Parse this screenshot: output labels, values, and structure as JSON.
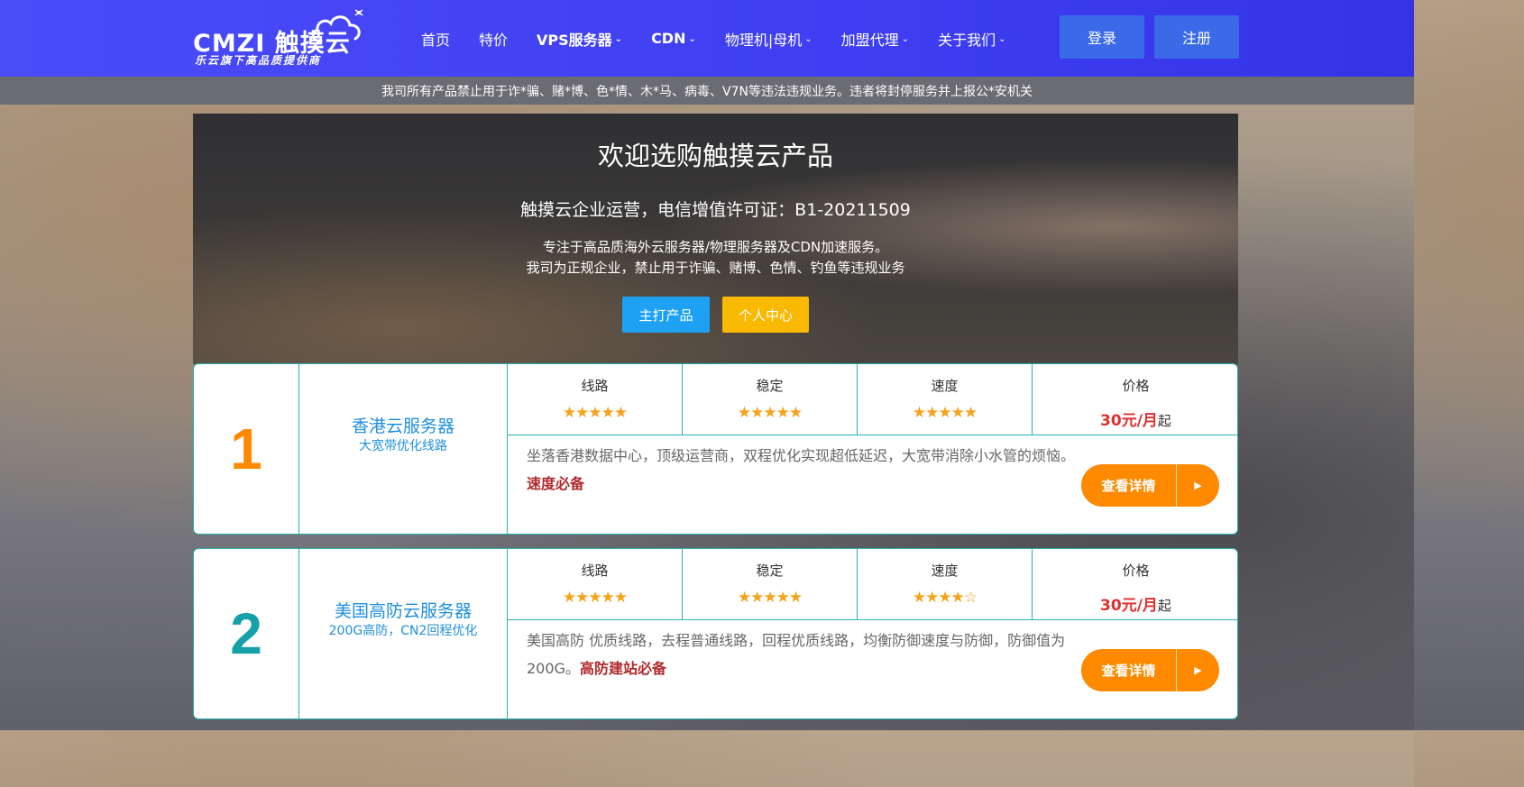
{
  "header": {
    "logo_text": "CMZI 触摸云",
    "logo_tagline": "乐云旗下高品质提供商",
    "nav": [
      {
        "label": "首页",
        "dropdown": false
      },
      {
        "label": "特价",
        "dropdown": false
      },
      {
        "label": "VPS服务器",
        "dropdown": true
      },
      {
        "label": "CDN",
        "dropdown": true
      },
      {
        "label": "物理机|母机",
        "dropdown": true
      },
      {
        "label": "加盟代理",
        "dropdown": true
      },
      {
        "label": "关于我们",
        "dropdown": true
      }
    ],
    "login_label": "登录",
    "register_label": "注册"
  },
  "notice": "我司所有产品禁止用于诈*骗、赌*博、色*情、木*马、病毒、V7N等违法违规业务。违者将封停服务并上报公*安机关",
  "hero": {
    "title": "欢迎选购触摸云产品",
    "license": "触摸云企业运营，电信增值许可证：B1-20211509",
    "desc_line1": "专注于高品质海外云服务器/物理服务器及CDN加速服务。",
    "desc_line2": "我司为正规企业，禁止用于诈骗、赌博、色情、钓鱼等违规业务",
    "primary_button": "主打产品",
    "secondary_button": "个人中心"
  },
  "products": [
    {
      "rank": "1",
      "name": "香港云服务器",
      "subtitle": "大宽带优化线路",
      "stats": [
        {
          "label": "线路",
          "rating": 5,
          "stars": "★★★★★"
        },
        {
          "label": "稳定",
          "rating": 5,
          "stars": "★★★★★"
        },
        {
          "label": "速度",
          "rating": 5,
          "stars": "★★★★★"
        }
      ],
      "price_label": "价格",
      "price": "30元/月",
      "price_suffix": "起",
      "description": "坐落香港数据中心，顶级运营商，双程优化实现超低延迟，大宽带消除小水管的烦恼。",
      "highlight": "速度必备",
      "button": "查看详情"
    },
    {
      "rank": "2",
      "name": "美国高防云服务器",
      "subtitle": "200G高防，CN2回程优化",
      "stats": [
        {
          "label": "线路",
          "rating": 5,
          "stars": "★★★★★"
        },
        {
          "label": "稳定",
          "rating": 5,
          "stars": "★★★★★"
        },
        {
          "label": "速度",
          "rating": 4.5,
          "stars": "★★★★☆"
        }
      ],
      "price_label": "价格",
      "price": "30元/月",
      "price_suffix": "起",
      "description": "美国高防 优质线路，去程普通线路，回程优质线路，均衡防御速度与防御，防御值为200G。",
      "highlight": "高防建站必备",
      "button": "查看详情"
    }
  ]
}
